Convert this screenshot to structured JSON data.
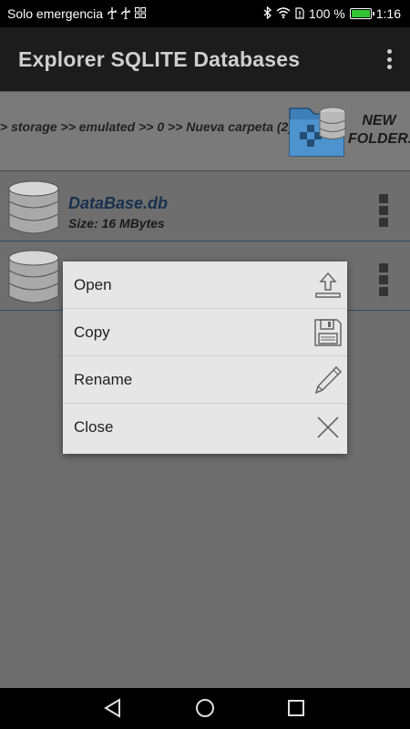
{
  "status_bar": {
    "carrier": "Solo emergencia",
    "battery_percent": "100 %",
    "time": "1:16",
    "battery_level": 1.0,
    "battery_color": "#33c433"
  },
  "app_bar": {
    "title": "Explorer SQLITE Databases",
    "menu_icon": "overflow-vertical-icon"
  },
  "path_bar": {
    "path": "> storage >> emulated >> 0 >> Nueva carpeta (2)",
    "new_folder_label_line1": "NEW",
    "new_folder_label_line2": "FOLDER."
  },
  "files": [
    {
      "name": "DataBase.db",
      "size": "Size: 16 MBytes"
    },
    {
      "name": "",
      "size": ""
    }
  ],
  "context_menu": {
    "items": [
      {
        "label": "Open",
        "icon": "upload-icon"
      },
      {
        "label": "Copy",
        "icon": "floppy-disk-icon"
      },
      {
        "label": "Rename",
        "icon": "pencil-icon"
      },
      {
        "label": "Close",
        "icon": "close-x-icon"
      }
    ]
  },
  "nav_bar": {
    "buttons": [
      "back-icon",
      "home-icon",
      "recents-icon"
    ]
  }
}
